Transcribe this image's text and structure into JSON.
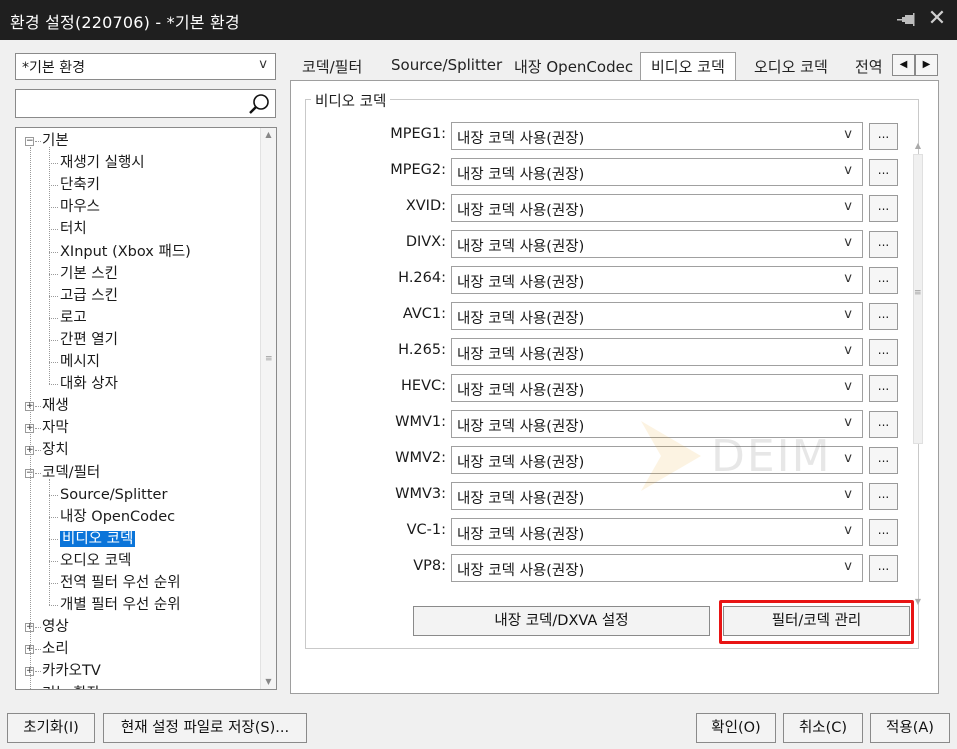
{
  "window": {
    "title": "환경 설정(220706) - *기본 환경",
    "close_glyph": "✕"
  },
  "profile_select": {
    "value": "*기본 환경",
    "arrow": "v"
  },
  "search": {
    "placeholder": ""
  },
  "tree": {
    "items": [
      {
        "label": "기본",
        "expander": "−"
      },
      {
        "label": "재생기 실행시"
      },
      {
        "label": "단축키"
      },
      {
        "label": "마우스"
      },
      {
        "label": "터치"
      },
      {
        "label": "XInput (Xbox 패드)"
      },
      {
        "label": "기본 스킨"
      },
      {
        "label": "고급 스킨"
      },
      {
        "label": "로고"
      },
      {
        "label": "간편 열기"
      },
      {
        "label": "메시지"
      },
      {
        "label": "대화 상자"
      },
      {
        "label": "재생",
        "expander": "+"
      },
      {
        "label": "자막",
        "expander": "+"
      },
      {
        "label": "장치",
        "expander": "+"
      },
      {
        "label": "코덱/필터",
        "expander": "−"
      },
      {
        "label": "Source/Splitter"
      },
      {
        "label": "내장 OpenCodec"
      },
      {
        "label": "비디오 코덱",
        "selected": true
      },
      {
        "label": "오디오 코덱"
      },
      {
        "label": "전역 필터 우선 순위"
      },
      {
        "label": "개별 필터 우선 순위"
      },
      {
        "label": "영상",
        "expander": "+"
      },
      {
        "label": "소리",
        "expander": "+"
      },
      {
        "label": "카카오TV",
        "expander": "+"
      },
      {
        "label": "기능 확장",
        "expander": "+"
      }
    ]
  },
  "tabs": [
    {
      "label": "코덱/필터"
    },
    {
      "label": "Source/Splitter"
    },
    {
      "label": "내장 OpenCodec"
    },
    {
      "label": "비디오 코덱",
      "active": true
    },
    {
      "label": "오디오 코덱"
    },
    {
      "label": "전역"
    }
  ],
  "tab_arrows": {
    "left": "◀",
    "right": "▶"
  },
  "group": {
    "title": "비디오 코덱",
    "more_label": "...",
    "arrow": "v",
    "codecs": [
      {
        "label": "MPEG1:",
        "value": "내장 코덱 사용(권장)"
      },
      {
        "label": "MPEG2:",
        "value": "내장 코덱 사용(권장)"
      },
      {
        "label": "XVID:",
        "value": "내장 코덱 사용(권장)"
      },
      {
        "label": "DIVX:",
        "value": "내장 코덱 사용(권장)"
      },
      {
        "label": "H.264:",
        "value": "내장 코덱 사용(권장)"
      },
      {
        "label": "AVC1:",
        "value": "내장 코덱 사용(권장)"
      },
      {
        "label": "H.265:",
        "value": "내장 코덱 사용(권장)"
      },
      {
        "label": "HEVC:",
        "value": "내장 코덱 사용(권장)"
      },
      {
        "label": "WMV1:",
        "value": "내장 코덱 사용(권장)"
      },
      {
        "label": "WMV2:",
        "value": "내장 코덱 사용(권장)"
      },
      {
        "label": "WMV3:",
        "value": "내장 코덱 사용(권장)"
      },
      {
        "label": "VC-1:",
        "value": "내장 코덱 사용(권장)"
      },
      {
        "label": "VP8:",
        "value": "내장 코덱 사용(권장)"
      }
    ]
  },
  "watermark": {
    "text": "DEIM"
  },
  "actions": {
    "dxva_label": "내장 코덱/DXVA 설정",
    "filter_manage_label": "필터/코덱 관리"
  },
  "bottom": {
    "reset_label": "초기화(I)",
    "save_file_label": "현재 설정 파일로 저장(S)...",
    "ok_label": "확인(O)",
    "cancel_label": "취소(C)",
    "apply_label": "적용(A)"
  },
  "colors": {
    "selection": "#0a74d9",
    "highlight": "#e81414",
    "titlebar": "#1f1f1f"
  }
}
